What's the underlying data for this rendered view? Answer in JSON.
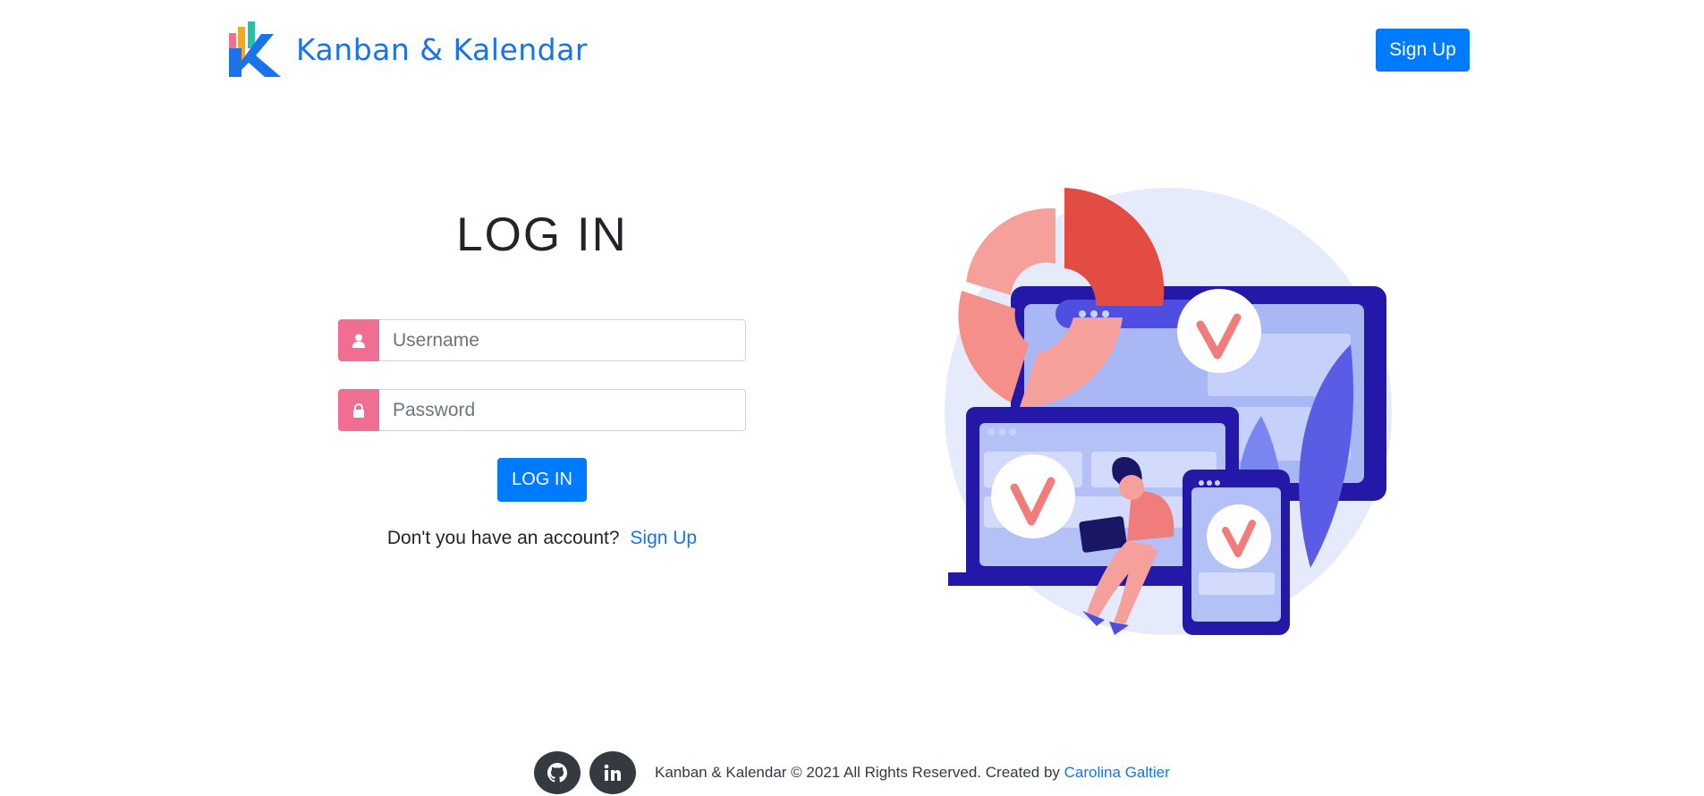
{
  "header": {
    "brand": "Kanban & Kalendar",
    "signup_label": "Sign Up"
  },
  "login": {
    "title": "LOG IN",
    "username_placeholder": "Username",
    "password_placeholder": "Password",
    "submit_label": "LOG IN",
    "no_account_text": "Don't you have an account?",
    "signup_link": "Sign Up"
  },
  "footer": {
    "copyright": "Kanban & Kalendar © 2021 All Rights Reserved. Created by",
    "author": "Carolina Galtier",
    "icons": [
      "github-icon",
      "linkedin-icon"
    ]
  },
  "colors": {
    "primary": "#007bff",
    "addon": "#f06e92",
    "link": "#1a73e8",
    "dark": "#343a40"
  }
}
